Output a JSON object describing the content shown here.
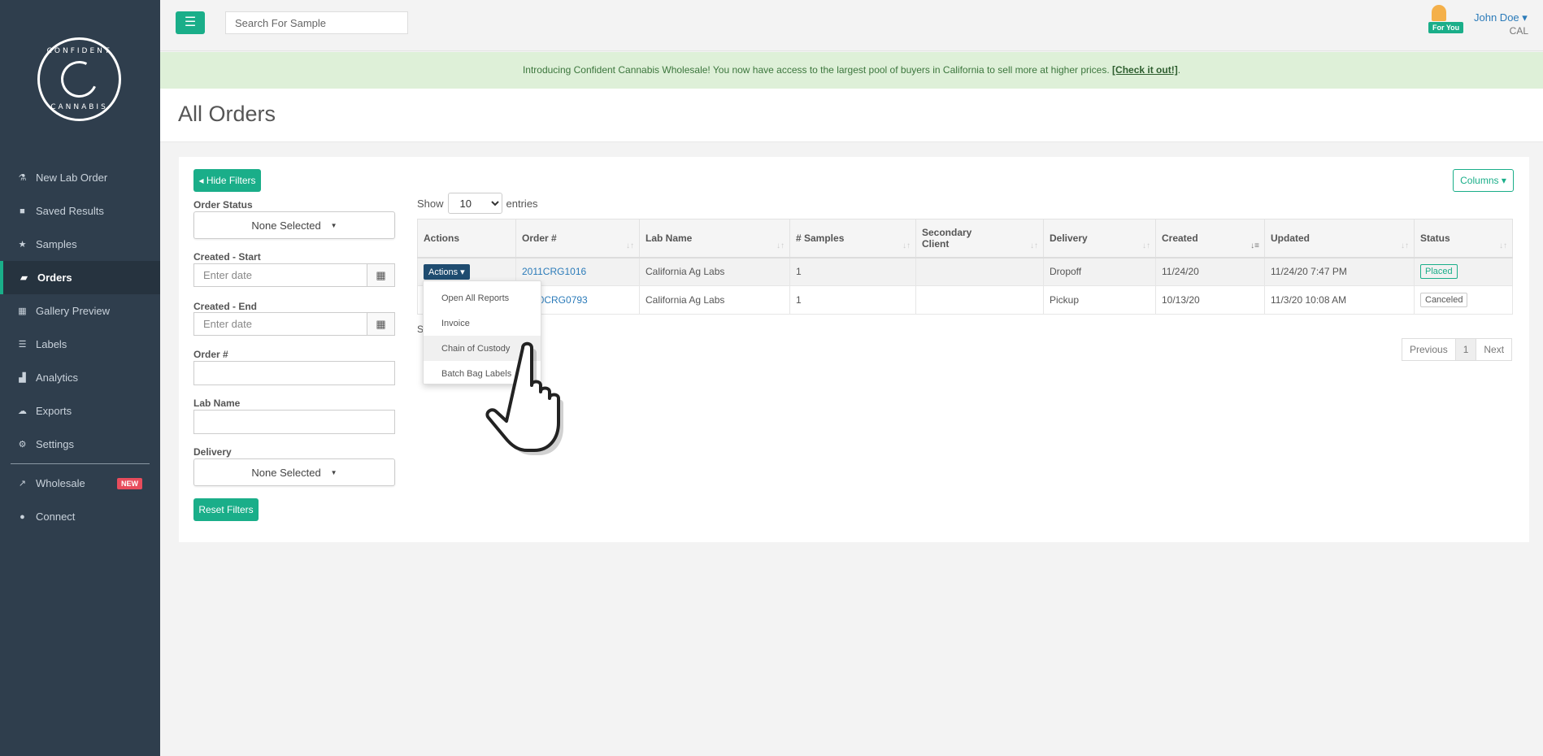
{
  "sidebar": {
    "logo_top": "CONFIDENT",
    "logo_bottom": "CANNABIS",
    "items": [
      {
        "label": "New Lab Order",
        "icon": "flask-icon",
        "glyph": "⚗"
      },
      {
        "label": "Saved Results",
        "icon": "bookmark-icon",
        "glyph": "■"
      },
      {
        "label": "Samples",
        "icon": "star-icon",
        "glyph": "★"
      },
      {
        "label": "Orders",
        "icon": "folder-open-icon",
        "glyph": "▰"
      },
      {
        "label": "Gallery Preview",
        "icon": "grid-icon",
        "glyph": "▦"
      },
      {
        "label": "Labels",
        "icon": "list-icon",
        "glyph": "☰"
      },
      {
        "label": "Analytics",
        "icon": "chart-icon",
        "glyph": "▟"
      },
      {
        "label": "Exports",
        "icon": "cloud-upload-icon",
        "glyph": "☁"
      },
      {
        "label": "Settings",
        "icon": "gear-icon",
        "glyph": "⚙"
      },
      {
        "label": "Wholesale",
        "icon": "external-link-icon",
        "glyph": "↗",
        "badge": "NEW"
      },
      {
        "label": "Connect",
        "icon": "connect-icon",
        "glyph": "●"
      }
    ]
  },
  "topbar": {
    "search_placeholder": "Search For Sample",
    "for_you": "For You",
    "user_name": "John Doe ▾",
    "user_org": "CAL"
  },
  "banner": {
    "text": "Introducing Confident Cannabis Wholesale! You now have access to the largest pool of buyers in California to sell more at higher prices. ",
    "link": "[Check it out!]",
    "suffix": "."
  },
  "page": {
    "title": "All Orders"
  },
  "filters": {
    "hide_label": "◂ Hide Filters",
    "order_status_label": "Order Status",
    "order_status_value": "None Selected",
    "created_start_label": "Created - Start",
    "created_end_label": "Created - End",
    "date_placeholder": "Enter date",
    "order_num_label": "Order #",
    "lab_name_label": "Lab Name",
    "delivery_label": "Delivery",
    "delivery_value": "None Selected",
    "reset_label": "Reset Filters"
  },
  "table": {
    "columns_btn": "Columns ▾",
    "show": "Show",
    "entries_value": "10",
    "entries": "entries",
    "headers": [
      "Actions",
      "Order #",
      "Lab Name",
      "# Samples",
      "Secondary Client",
      "Delivery",
      "Created",
      "Updated",
      "Status"
    ],
    "rows": [
      {
        "actions": "Actions ▾",
        "order": "2011CRG1016",
        "lab": "California Ag Labs",
        "samples": "1",
        "secondary": "",
        "delivery": "Dropoff",
        "created": "11/24/20",
        "updated": "11/24/20 7:47 PM",
        "status": "Placed"
      },
      {
        "actions": "",
        "order": "20CRG0793",
        "lab": "California Ag Labs",
        "samples": "1",
        "secondary": "",
        "delivery": "Pickup",
        "created": "10/13/20",
        "updated": "11/3/20 10:08 AM",
        "status": "Canceled"
      }
    ],
    "showing_stub": "S",
    "pager": {
      "prev": "Previous",
      "page": "1",
      "next": "Next"
    }
  },
  "actions_menu": [
    "Open All Reports",
    "Invoice",
    "Chain of Custody",
    "Batch Bag Labels"
  ]
}
